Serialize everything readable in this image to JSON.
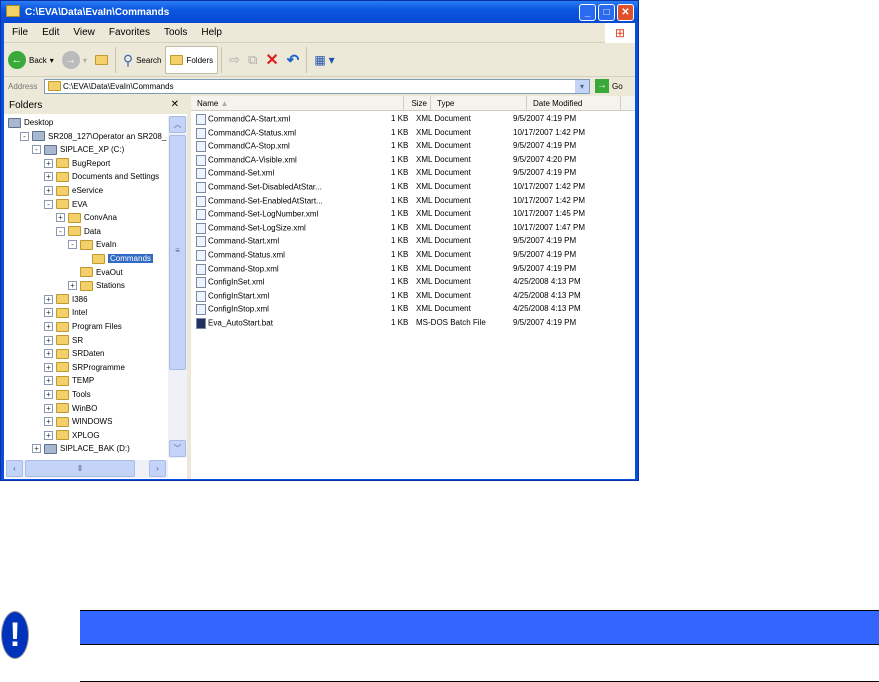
{
  "window": {
    "title": "C:\\EVA\\Data\\EvaIn\\Commands",
    "minimize": "_",
    "maximize": "□",
    "close": "✕"
  },
  "menu": [
    "File",
    "Edit",
    "View",
    "Favorites",
    "Tools",
    "Help"
  ],
  "toolbar": {
    "back": "Back",
    "search": "Search",
    "folders": "Folders"
  },
  "address": {
    "label": "Address",
    "value": "C:\\EVA\\Data\\EvaIn\\Commands",
    "go": "Go"
  },
  "folders_pane": {
    "title": "Folders",
    "close": "✕"
  },
  "tree": [
    {
      "label": "Desktop",
      "level": 0,
      "exp": ""
    },
    {
      "label": "SR208_127\\Operator an SR208_",
      "level": 1,
      "exp": "-"
    },
    {
      "label": "SIPLACE_XP (C:)",
      "level": 2,
      "exp": "-"
    },
    {
      "label": "BugReport",
      "level": 3,
      "exp": "+"
    },
    {
      "label": "Documents and Settings",
      "level": 3,
      "exp": "+"
    },
    {
      "label": "eService",
      "level": 3,
      "exp": "+"
    },
    {
      "label": "EVA",
      "level": 3,
      "exp": "-"
    },
    {
      "label": "ConvAna",
      "level": 4,
      "exp": "+"
    },
    {
      "label": "Data",
      "level": 4,
      "exp": "-"
    },
    {
      "label": "EvaIn",
      "level": 5,
      "exp": "-"
    },
    {
      "label": "Commands",
      "level": 6,
      "exp": "",
      "selected": true
    },
    {
      "label": "EvaOut",
      "level": 5,
      "exp": ""
    },
    {
      "label": "Stations",
      "level": 5,
      "exp": "+"
    },
    {
      "label": "I386",
      "level": 3,
      "exp": "+"
    },
    {
      "label": "Intel",
      "level": 3,
      "exp": "+"
    },
    {
      "label": "Program Files",
      "level": 3,
      "exp": "+"
    },
    {
      "label": "SR",
      "level": 3,
      "exp": "+"
    },
    {
      "label": "SRDaten",
      "level": 3,
      "exp": "+"
    },
    {
      "label": "SRProgramme",
      "level": 3,
      "exp": "+"
    },
    {
      "label": "TEMP",
      "level": 3,
      "exp": "+"
    },
    {
      "label": "Tools",
      "level": 3,
      "exp": "+"
    },
    {
      "label": "WinBO",
      "level": 3,
      "exp": "+"
    },
    {
      "label": "WINDOWS",
      "level": 3,
      "exp": "+"
    },
    {
      "label": "XPLOG",
      "level": 3,
      "exp": "+"
    },
    {
      "label": "SIPLACE_BAK (D:)",
      "level": 2,
      "exp": "+"
    }
  ],
  "columns": [
    "Name",
    "Size",
    "Type",
    "Date Modified"
  ],
  "files": [
    [
      "CommandCA-Start.xml",
      "1 KB",
      "XML Document",
      "9/5/2007 4:19 PM"
    ],
    [
      "CommandCA-Status.xml",
      "1 KB",
      "XML Document",
      "10/17/2007 1:42 PM"
    ],
    [
      "CommandCA-Stop.xml",
      "1 KB",
      "XML Document",
      "9/5/2007 4:19 PM"
    ],
    [
      "CommandCA-Visible.xml",
      "1 KB",
      "XML Document",
      "9/5/2007 4:20 PM"
    ],
    [
      "Command-Set.xml",
      "1 KB",
      "XML Document",
      "9/5/2007 4:19 PM"
    ],
    [
      "Command-Set-DisabledAtStar...",
      "1 KB",
      "XML Document",
      "10/17/2007 1:42 PM"
    ],
    [
      "Command-Set-EnabledAtStart...",
      "1 KB",
      "XML Document",
      "10/17/2007 1:42 PM"
    ],
    [
      "Command-Set-LogNumber.xml",
      "1 KB",
      "XML Document",
      "10/17/2007 1:45 PM"
    ],
    [
      "Command-Set-LogSize.xml",
      "1 KB",
      "XML Document",
      "10/17/2007 1:47 PM"
    ],
    [
      "Command-Start.xml",
      "1 KB",
      "XML Document",
      "9/5/2007 4:19 PM"
    ],
    [
      "Command-Status.xml",
      "1 KB",
      "XML Document",
      "9/5/2007 4:19 PM"
    ],
    [
      "Command-Stop.xml",
      "1 KB",
      "XML Document",
      "9/5/2007 4:19 PM"
    ],
    [
      "ConfigInSet.xml",
      "1 KB",
      "XML Document",
      "4/25/2008 4:13 PM"
    ],
    [
      "ConfigInStart.xml",
      "1 KB",
      "XML Document",
      "4/25/2008 4:13 PM"
    ],
    [
      "ConfigInStop.xml",
      "1 KB",
      "XML Document",
      "4/25/2008 4:13 PM"
    ],
    [
      "Eva_AutoStart.bat",
      "1 KB",
      "MS-DOS Batch File",
      "9/5/2007 4:19 PM"
    ]
  ],
  "notice": {
    "icon": "exclamation",
    "color": "#3366ff",
    "mark": "!"
  }
}
